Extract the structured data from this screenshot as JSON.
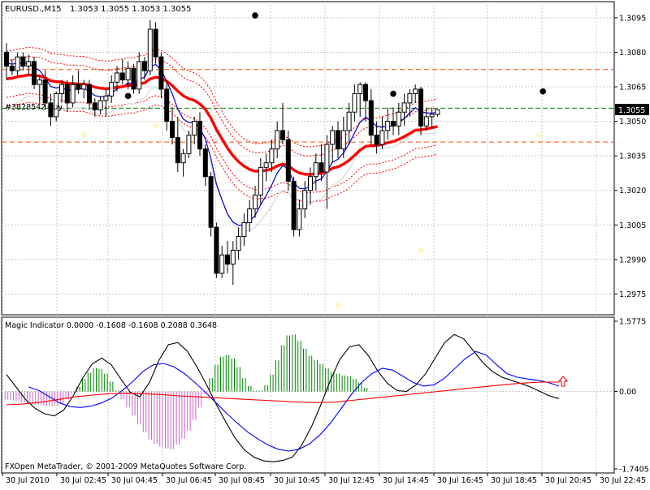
{
  "header": {
    "symbol": "EURUSD.,M15",
    "ohlc": "1.3053 1.3055 1.3053 1.3055"
  },
  "order_label": "#3828542 buy",
  "price_badge": "1.3055",
  "indicator_header": "Magic Indicator 0.0000 -0.1608 -0.1608 0.2088 0.3648",
  "footer": "FXOpen MetaTrader, © 2001-2009 MetaQuotes Software Corp.",
  "colors": {
    "bull_candle": "#ffffff",
    "bear_candle": "#000000",
    "ma_thick": "#ff0000",
    "ma_blue": "#0000cc",
    "ma_white": "#ffffff",
    "envelope": "#ff0000",
    "order_line": "#008000",
    "level_line": "#ff5000",
    "hist_pos": "#008000",
    "hist_neg": "#cc66cc",
    "osc_black": "#000000",
    "osc_blue": "#0000ff",
    "osc_red": "#ff0000",
    "grid": "#c8c8c8",
    "badge_bg": "#000000"
  },
  "chart_data": [
    {
      "type": "candlestick",
      "title": "EURUSD.,M15",
      "ylim": [
        1.2966,
        1.3102
      ],
      "price_ticks": [
        "1.3095",
        "1.3080",
        "1.3065",
        "1.3050",
        "1.3035",
        "1.3020",
        "1.3005",
        "1.2990",
        "1.2975"
      ],
      "time_ticks": [
        "30 Jul 2010",
        "30 Jul 02:45",
        "30 Jul 04:45",
        "30 Jul 06:45",
        "30 Jul 08:45",
        "30 Jul 10:45",
        "30 Jul 12:45",
        "30 Jul 14:45",
        "30 Jul 16:45",
        "30 Jul 18:45",
        "30 Jul 20:45",
        "30 Jul 22:45"
      ],
      "levels": {
        "order": 1.30557,
        "upper_dash": 1.30725,
        "lower_dash": 1.3041
      },
      "current_price": 1.3055,
      "candles": [
        [
          1.308,
          1.3084,
          1.3068,
          1.3074
        ],
        [
          1.3074,
          1.3077,
          1.307,
          1.3072
        ],
        [
          1.3072,
          1.308,
          1.307,
          1.3078
        ],
        [
          1.3078,
          1.308,
          1.3072,
          1.3074
        ],
        [
          1.3074,
          1.3079,
          1.307,
          1.3076
        ],
        [
          1.3076,
          1.3078,
          1.3064,
          1.3066
        ],
        [
          1.3066,
          1.307,
          1.3058,
          1.3068
        ],
        [
          1.3068,
          1.3072,
          1.3055,
          1.3058
        ],
        [
          1.3058,
          1.3062,
          1.3048,
          1.3052
        ],
        [
          1.3052,
          1.3063,
          1.305,
          1.3062
        ],
        [
          1.3062,
          1.3068,
          1.3058,
          1.3066
        ],
        [
          1.3066,
          1.3068,
          1.3054,
          1.3058
        ],
        [
          1.3058,
          1.307,
          1.3056,
          1.3066
        ],
        [
          1.3066,
          1.3072,
          1.3062,
          1.3064
        ],
        [
          1.3064,
          1.3068,
          1.306,
          1.3066
        ],
        [
          1.3066,
          1.3068,
          1.3055,
          1.3058
        ],
        [
          1.3058,
          1.306,
          1.3052,
          1.3055
        ],
        [
          1.3055,
          1.3061,
          1.3053,
          1.3059
        ],
        [
          1.3059,
          1.3064,
          1.3052,
          1.3061
        ],
        [
          1.3061,
          1.307,
          1.3058,
          1.3067
        ],
        [
          1.3067,
          1.3074,
          1.3063,
          1.3071
        ],
        [
          1.3071,
          1.3077,
          1.3066,
          1.3068
        ],
        [
          1.3068,
          1.3076,
          1.3064,
          1.3073
        ],
        [
          1.3073,
          1.3075,
          1.3062,
          1.3064
        ],
        [
          1.3064,
          1.308,
          1.3062,
          1.3076
        ],
        [
          1.3076,
          1.3078,
          1.3068,
          1.3072
        ],
        [
          1.3072,
          1.3094,
          1.307,
          1.309
        ],
        [
          1.309,
          1.3093,
          1.3075,
          1.3078
        ],
        [
          1.3078,
          1.308,
          1.306,
          1.3064
        ],
        [
          1.3064,
          1.3068,
          1.3046,
          1.305
        ],
        [
          1.305,
          1.3056,
          1.304,
          1.3043
        ],
        [
          1.3043,
          1.3052,
          1.3028,
          1.3032
        ],
        [
          1.3032,
          1.3038,
          1.3026,
          1.3036
        ],
        [
          1.3036,
          1.3046,
          1.3034,
          1.3044
        ],
        [
          1.3044,
          1.3052,
          1.304,
          1.305
        ],
        [
          1.305,
          1.3054,
          1.3035,
          1.3038
        ],
        [
          1.3038,
          1.304,
          1.3022,
          1.3026
        ],
        [
          1.3026,
          1.3028,
          1.3,
          1.3004
        ],
        [
          1.3004,
          1.3006,
          1.2982,
          1.2984
        ],
        [
          1.2984,
          1.2996,
          1.2982,
          1.2992
        ],
        [
          1.2992,
          1.2998,
          1.2984,
          1.2988
        ],
        [
          1.2988,
          1.2998,
          1.2979,
          1.2994
        ],
        [
          1.2994,
          1.3004,
          1.299,
          1.3
        ],
        [
          1.3,
          1.301,
          1.2996,
          1.3006
        ],
        [
          1.3006,
          1.3016,
          1.3002,
          1.3012
        ],
        [
          1.3012,
          1.3022,
          1.3008,
          1.3018
        ],
        [
          1.3018,
          1.3034,
          1.3014,
          1.303
        ],
        [
          1.303,
          1.3036,
          1.3024,
          1.3032
        ],
        [
          1.3032,
          1.3042,
          1.3028,
          1.3038
        ],
        [
          1.3038,
          1.305,
          1.3034,
          1.3046
        ],
        [
          1.3046,
          1.3058,
          1.304,
          1.3042
        ],
        [
          1.3042,
          1.3046,
          1.302,
          1.3024
        ],
        [
          1.3024,
          1.3026,
          1.3,
          1.3003
        ],
        [
          1.3003,
          1.3016,
          1.3,
          1.3012
        ],
        [
          1.3012,
          1.3024,
          1.3008,
          1.302
        ],
        [
          1.302,
          1.303,
          1.3014,
          1.3026
        ],
        [
          1.3026,
          1.3036,
          1.302,
          1.3032
        ],
        [
          1.3032,
          1.304,
          1.3024,
          1.3028
        ],
        [
          1.3028,
          1.3044,
          1.3012,
          1.304
        ],
        [
          1.304,
          1.3048,
          1.3032,
          1.3046
        ],
        [
          1.3046,
          1.305,
          1.3034,
          1.3038
        ],
        [
          1.3038,
          1.3052,
          1.3034,
          1.3046
        ],
        [
          1.3046,
          1.3058,
          1.304,
          1.3054
        ],
        [
          1.3054,
          1.3066,
          1.305,
          1.3062
        ],
        [
          1.3062,
          1.3067,
          1.3052,
          1.3066
        ],
        [
          1.3066,
          1.3067,
          1.305,
          1.3059
        ],
        [
          1.3059,
          1.3064,
          1.304,
          1.3044
        ],
        [
          1.3044,
          1.305,
          1.3036,
          1.304
        ],
        [
          1.304,
          1.3052,
          1.3038,
          1.3046
        ],
        [
          1.3046,
          1.3056,
          1.3042,
          1.305
        ],
        [
          1.305,
          1.3056,
          1.3044,
          1.3048
        ],
        [
          1.3048,
          1.3058,
          1.3044,
          1.3054
        ],
        [
          1.3054,
          1.3062,
          1.3048,
          1.3058
        ],
        [
          1.3058,
          1.3064,
          1.3052,
          1.3062
        ],
        [
          1.3062,
          1.3066,
          1.3058,
          1.3064
        ],
        [
          1.3064,
          1.3065,
          1.3044,
          1.3048
        ],
        [
          1.3048,
          1.3056,
          1.3046,
          1.3052
        ],
        [
          1.3052,
          1.3056,
          1.3047,
          1.3053
        ],
        [
          1.3053,
          1.3055,
          1.3052,
          1.3055
        ]
      ],
      "dots_above": [
        [
          22,
          1.3061
        ],
        [
          45,
          1.3096
        ],
        [
          70,
          1.3062
        ],
        [
          99,
          1.3063
        ]
      ],
      "dots_below": [
        [
          14,
          1.3044
        ],
        [
          27,
          1.3048
        ],
        [
          60,
          1.297
        ],
        [
          75,
          1.2994
        ],
        [
          100,
          1.3044
        ]
      ]
    },
    {
      "type": "oscillator",
      "title": "Magic Indicator",
      "ylim": [
        -1.7405,
        1.5775
      ],
      "value_ticks": [
        "1.5775",
        "0.00",
        "-1.7405"
      ],
      "histogram": [
        -0.18,
        -0.2,
        -0.22,
        -0.24,
        -0.27,
        -0.29,
        -0.31,
        -0.32,
        -0.33,
        -0.32,
        -0.28,
        -0.18,
        -0.05,
        0.1,
        0.28,
        0.42,
        0.52,
        0.5,
        0.4,
        0.22,
        0.02,
        -0.18,
        -0.36,
        -0.54,
        -0.74,
        -0.92,
        -1.08,
        -1.18,
        -1.24,
        -1.28,
        -1.3,
        -1.2,
        -1.06,
        -0.88,
        -0.64,
        -0.36,
        -0.04,
        0.3,
        0.6,
        0.78,
        0.82,
        0.74,
        0.55,
        0.3,
        0.12,
        0.02,
        0.02,
        0.14,
        0.38,
        0.7,
        1.04,
        1.26,
        1.28,
        1.14,
        0.96,
        0.8,
        0.7,
        0.62,
        0.52,
        0.44,
        0.4,
        0.36,
        0.34,
        0.28,
        0.2,
        0.08
      ],
      "hist_start": 0,
      "line_black": [
        0.38,
        0.1,
        -0.18,
        -0.38,
        -0.5,
        -0.55,
        -0.42,
        -0.1,
        0.3,
        0.62,
        0.75,
        0.6,
        0.28,
        -0.02,
        -0.12,
        0.2,
        0.7,
        1.05,
        1.1,
        0.9,
        0.55,
        0.15,
        -0.28,
        -0.68,
        -1.05,
        -1.32,
        -1.48,
        -1.56,
        -1.58,
        -1.55,
        -1.48,
        -1.2,
        -0.8,
        -0.3,
        0.25,
        0.72,
        1.0,
        1.05,
        0.8,
        0.45,
        0.18,
        0.02,
        0.0,
        0.15,
        0.4,
        0.75,
        1.1,
        1.28,
        1.18,
        0.92,
        0.65,
        0.45,
        0.32,
        0.25,
        0.18,
        0.1,
        0.0,
        -0.1,
        -0.16
      ],
      "line_black_start": 0,
      "line_blue": [
        0.1,
        0.02,
        -0.12,
        -0.26,
        -0.34,
        -0.36,
        -0.33,
        -0.26,
        -0.15,
        0.02,
        0.22,
        0.45,
        0.6,
        0.63,
        0.55,
        0.4,
        0.2,
        -0.02,
        -0.25,
        -0.48,
        -0.7,
        -0.9,
        -1.06,
        -1.2,
        -1.3,
        -1.34,
        -1.3,
        -1.18,
        -0.98,
        -0.72,
        -0.4,
        -0.08,
        0.2,
        0.4,
        0.52,
        0.48,
        0.34,
        0.2,
        0.12,
        0.15,
        0.3,
        0.52,
        0.74,
        0.9,
        0.82,
        0.6,
        0.4,
        0.32,
        0.28,
        0.25,
        0.2,
        0.12
      ],
      "line_blue_start": 4,
      "line_red": [
        -0.3,
        -0.28,
        -0.24,
        -0.18,
        -0.12,
        -0.08,
        -0.05,
        -0.04,
        -0.05,
        -0.07,
        -0.1,
        -0.12,
        -0.14,
        -0.16,
        -0.18,
        -0.2,
        -0.22,
        -0.24,
        -0.25,
        -0.24,
        -0.2,
        -0.16,
        -0.12,
        -0.08,
        -0.04,
        0.0,
        0.04,
        0.08,
        0.12,
        0.16,
        0.19,
        0.21,
        0.21
      ],
      "line_red_start": 18,
      "line_red_step": 2
    }
  ]
}
